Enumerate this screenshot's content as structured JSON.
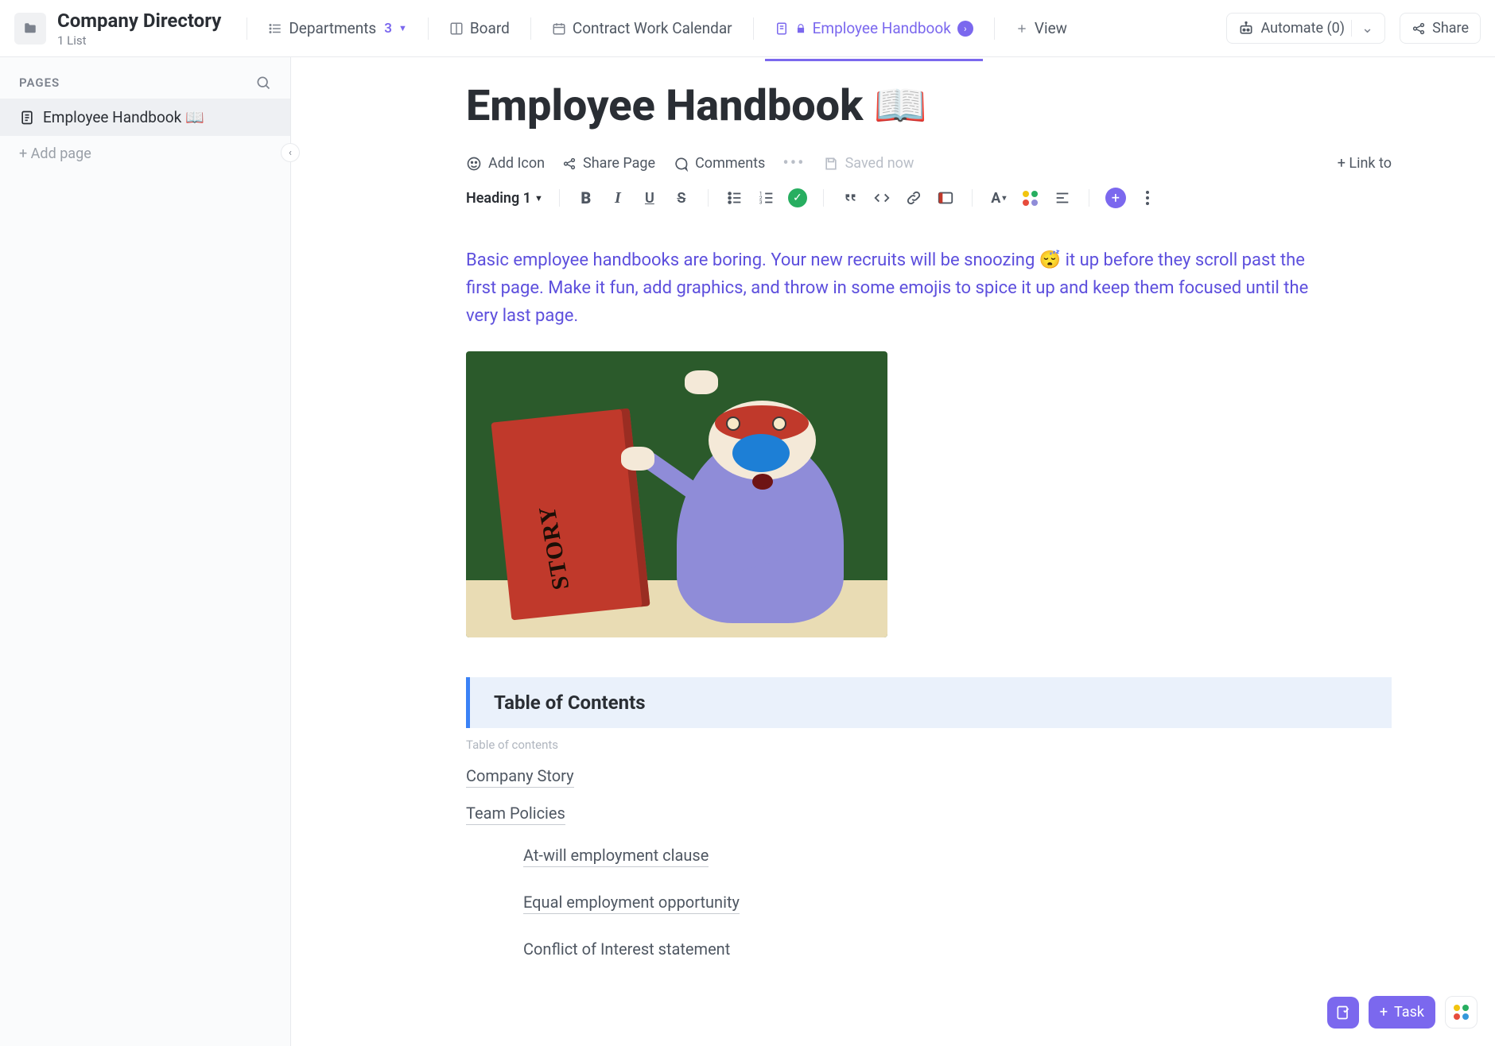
{
  "header": {
    "workspace_title": "Company Directory",
    "workspace_subtitle": "1 List",
    "tabs": {
      "departments": "Departments",
      "departments_count": "3",
      "board": "Board",
      "calendar": "Contract Work Calendar",
      "handbook": "Employee Handbook",
      "view": "View"
    },
    "automate": "Automate (0)",
    "share": "Share"
  },
  "sidebar": {
    "heading": "PAGES",
    "items": [
      {
        "label": "Employee Handbook 📖"
      }
    ],
    "add_page": "+ Add page"
  },
  "doc": {
    "title": "Employee Handbook 📖",
    "menu": {
      "add_icon": "Add Icon",
      "share_page": "Share Page",
      "comments": "Comments",
      "saved": "Saved now",
      "link_to": "+ Link to"
    },
    "format": {
      "heading_label": "Heading 1"
    },
    "intro": "Basic employee handbooks are boring. Your new recruits will be snoozing 😴 it up before they scroll past the first page. Make it fun, add graphics, and throw in some emojis to spice it up and keep them focused until the very last page.",
    "image_book_label": "STORY",
    "toc": {
      "title": "Table of Contents",
      "caption": "Table of contents",
      "items": {
        "company_story": "Company Story",
        "team_policies": "Team Policies",
        "at_will": "At-will employment clause",
        "eeo": "Equal employment opportunity",
        "conflict": "Conflict of Interest statement"
      }
    }
  },
  "floaters": {
    "task": "Task"
  }
}
